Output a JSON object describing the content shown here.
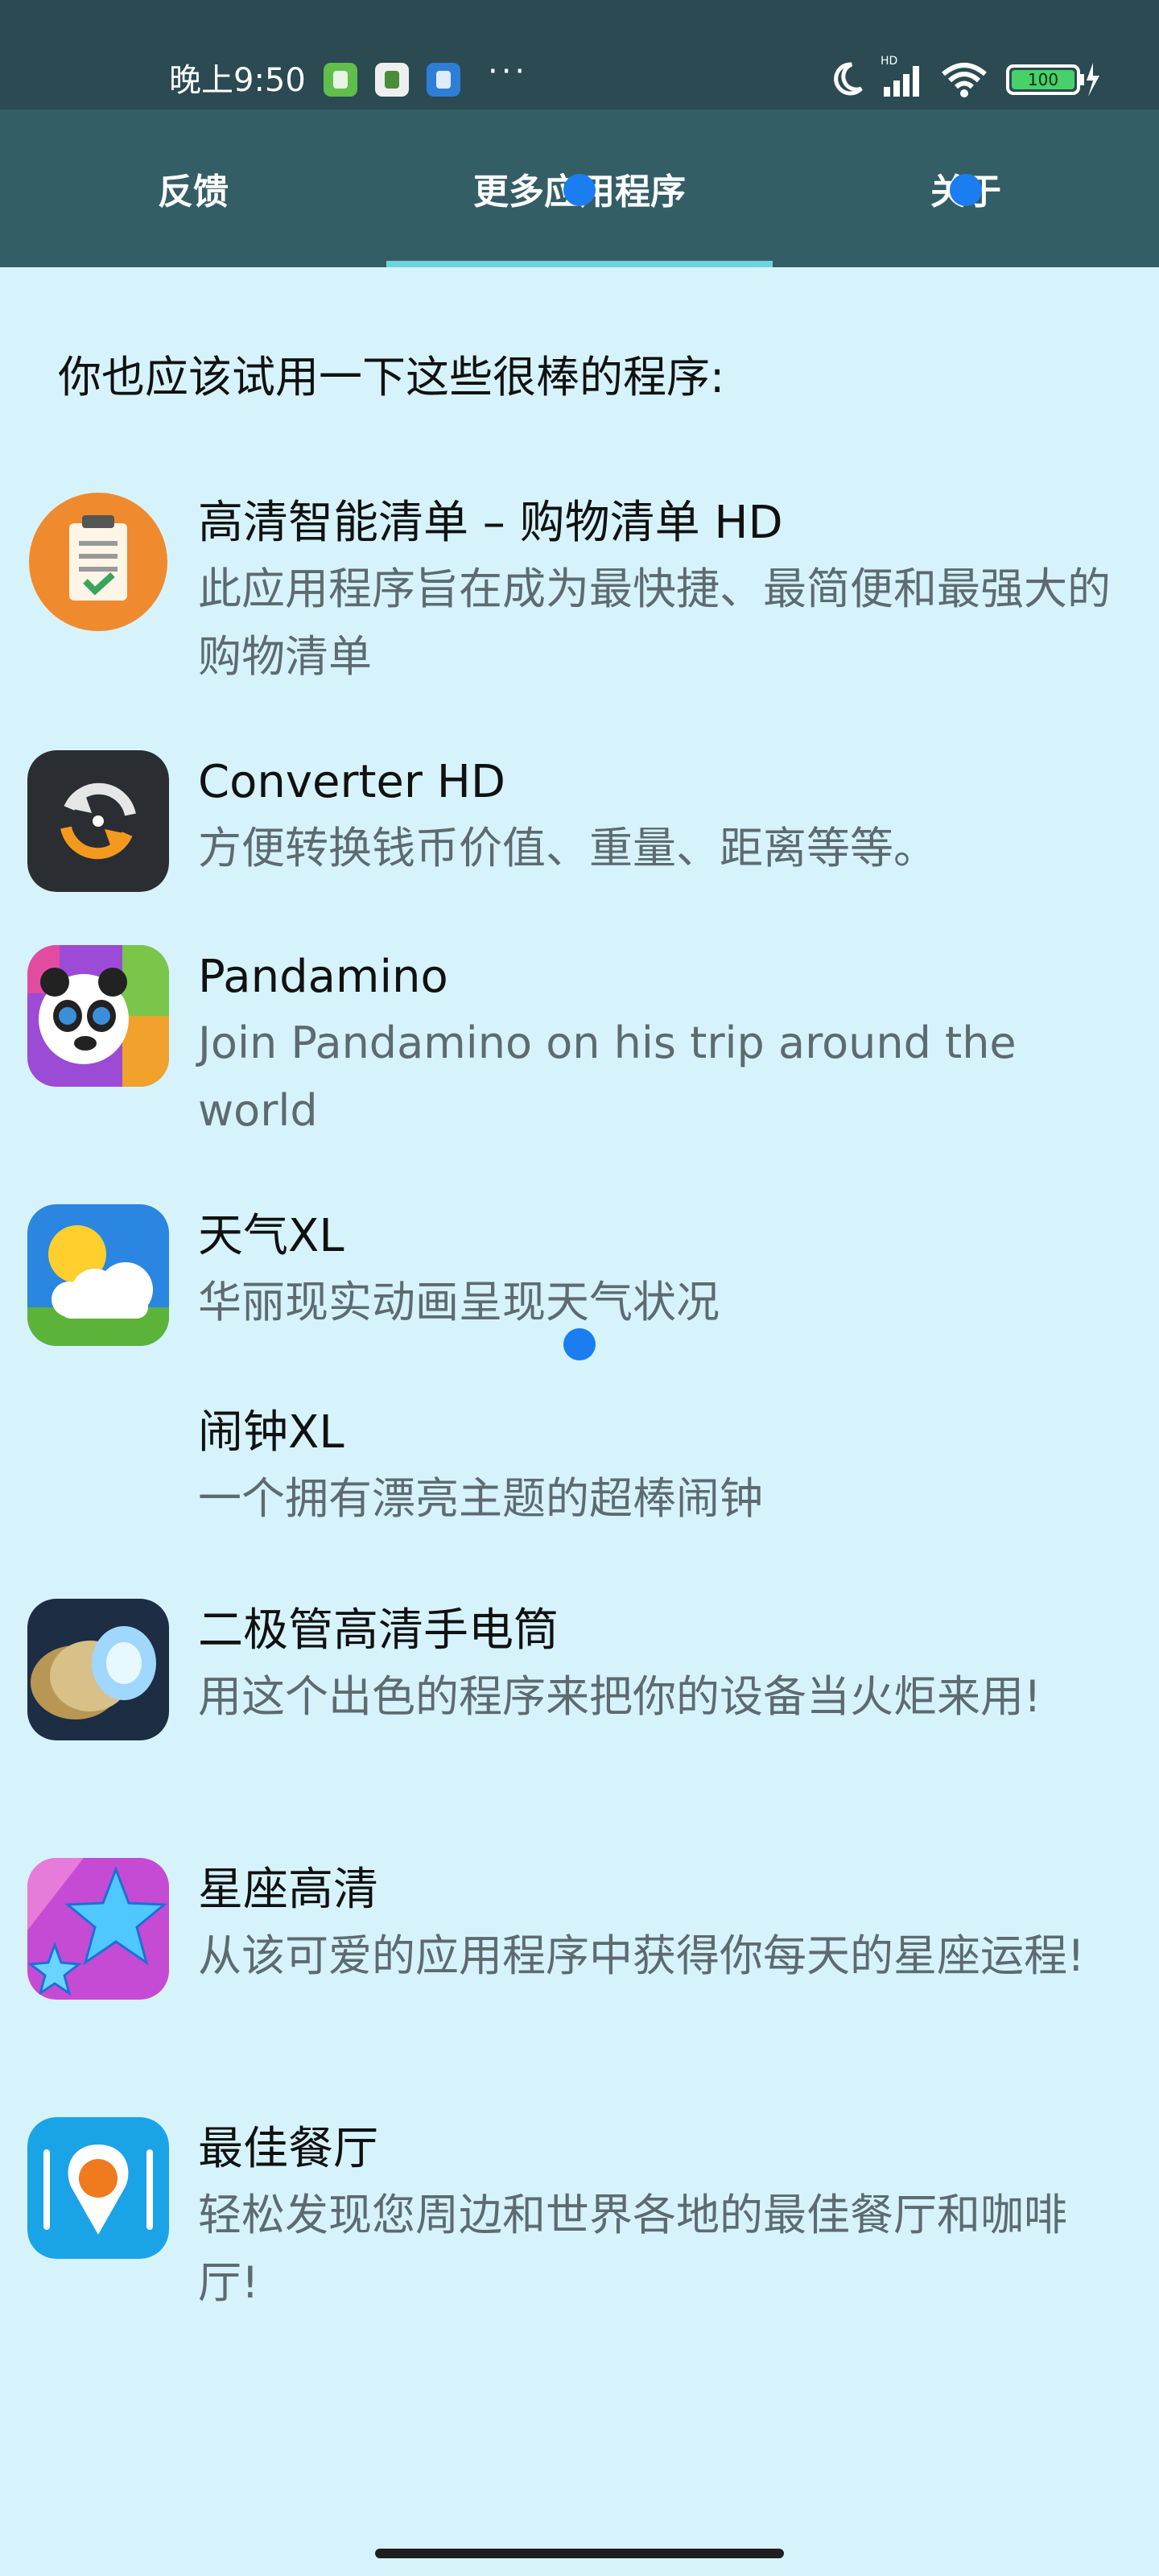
{
  "statusbar": {
    "time": "晚上9:50",
    "more": "···",
    "icons": [
      "app-notification-icon",
      "app-notification-icon",
      "app-notification-icon",
      "moon-icon",
      "signal-icon",
      "wifi-icon",
      "battery-icon"
    ],
    "battery": "100"
  },
  "tabs": [
    {
      "label": "反馈"
    },
    {
      "label": "更多应用程序"
    },
    {
      "label": "关于"
    }
  ],
  "intro": "你也应该试用一下这些很棒的程序:",
  "apps": [
    {
      "title": "高清智能清单 – 购物清单 HD",
      "desc": "此应用程序旨在成为最快捷、最简便和最强大的购物清单",
      "icon": "shopping-list-icon"
    },
    {
      "title": "Converter HD",
      "desc": "方便转换钱币价值、重量、距离等等。",
      "icon": "converter-icon"
    },
    {
      "title": "Pandamino",
      "desc": "Join Pandamino on his trip around the world",
      "icon": "pandamino-icon"
    },
    {
      "title": "天气XL",
      "desc": "华丽现实动画呈现天气状况",
      "icon": "weather-icon"
    },
    {
      "title": "闹钟XL",
      "desc": "一个拥有漂亮主题的超棒闹钟",
      "icon": "alarm-icon"
    },
    {
      "title": "二极管高清手电筒",
      "desc": "用这个出色的程序来把你的设备当火炬来用!",
      "icon": "flashlight-icon"
    },
    {
      "title": "星座高清",
      "desc": "从该可爱的应用程序中获得你每天的星座运程!",
      "icon": "horoscope-icon"
    },
    {
      "title": "最佳餐厅",
      "desc": "轻松发现您周边和世界各地的最佳餐厅和咖啡厅!",
      "icon": "restaurant-icon"
    }
  ],
  "colors": {
    "statusbar": "#2b4a52",
    "tabbar": "#345e66",
    "indicator": "#6fd3db",
    "background": "#d6f3fb",
    "touch_dot": "#1a7ef0"
  }
}
